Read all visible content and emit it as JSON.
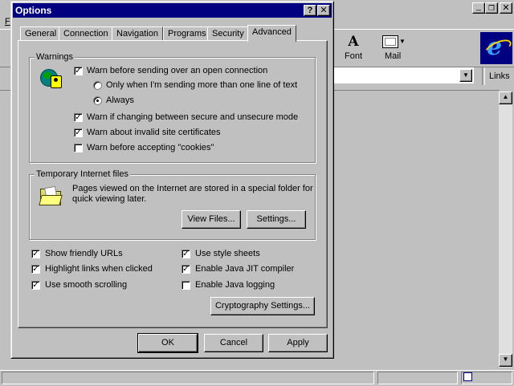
{
  "background_app": {
    "menu_letter": "F",
    "toolbar": {
      "font_label": "Font",
      "mail_label": "Mail"
    },
    "links_label": "Links"
  },
  "dialog": {
    "title": "Options",
    "tabs": [
      "General",
      "Connection",
      "Navigation",
      "Programs",
      "Security",
      "Advanced"
    ],
    "active_tab": "Advanced",
    "warnings": {
      "label": "Warnings",
      "items": [
        {
          "label": "Warn before sending over an open connection",
          "checked": true
        },
        {
          "label": "Warn if changing between secure and unsecure mode",
          "checked": true
        },
        {
          "label": "Warn about invalid site certificates",
          "checked": true
        },
        {
          "label": "Warn before accepting \"cookies\"",
          "checked": false
        }
      ],
      "radios": [
        {
          "label": "Only when I'm sending  more than one line of text",
          "selected": false
        },
        {
          "label": "Always",
          "selected": true
        }
      ]
    },
    "temp_files": {
      "label": "Temporary Internet files",
      "description_line1": "Pages viewed on the Internet are stored in a special folder for",
      "description_line2": "quick viewing later.",
      "view_files_button": "View Files...",
      "settings_button": "Settings..."
    },
    "options": {
      "left": [
        {
          "label": "Show friendly URLs",
          "checked": true
        },
        {
          "label": "Highlight links when clicked",
          "checked": true
        },
        {
          "label": "Use smooth scrolling",
          "checked": true
        }
      ],
      "right": [
        {
          "label": "Use style sheets",
          "checked": true
        },
        {
          "label": "Enable Java JIT compiler",
          "checked": true
        },
        {
          "label": "Enable Java logging",
          "checked": false
        }
      ]
    },
    "crypto_button": "Cryptography Settings...",
    "ok_button": "OK",
    "cancel_button": "Cancel",
    "apply_button": "Apply"
  },
  "colors": {
    "title_bar": "#000080",
    "ie_logo_bg": "#000080",
    "face": "#c0c0c0"
  },
  "icons": [
    "security-globe-icon",
    "folder-icon",
    "internet-explorer-logo-icon",
    "font-icon",
    "mail-icon"
  ]
}
